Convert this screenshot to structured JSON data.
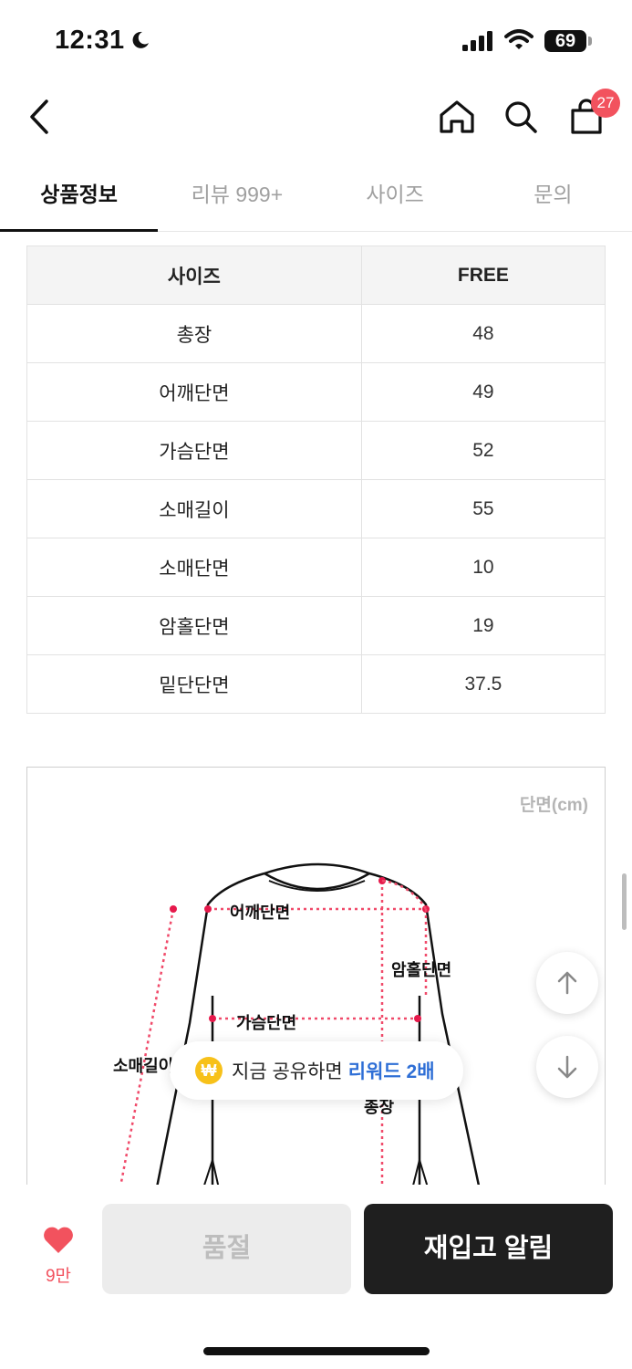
{
  "status_bar": {
    "time": "12:31",
    "battery": "69"
  },
  "header": {
    "cart_count": "27"
  },
  "tabs": [
    {
      "label": "상품정보",
      "active": true
    },
    {
      "label": "리뷰 999+",
      "active": false
    },
    {
      "label": "사이즈",
      "active": false
    },
    {
      "label": "문의",
      "active": false
    }
  ],
  "size_table": {
    "header": [
      "사이즈",
      "FREE"
    ],
    "rows": [
      [
        "총장",
        "48"
      ],
      [
        "어깨단면",
        "49"
      ],
      [
        "가슴단면",
        "52"
      ],
      [
        "소매길이",
        "55"
      ],
      [
        "소매단면",
        "10"
      ],
      [
        "암홀단면",
        "19"
      ],
      [
        "밑단단면",
        "37.5"
      ]
    ]
  },
  "diagram": {
    "unit": "단면(cm)",
    "labels": {
      "shoulder": "어깨단면",
      "armhole": "암홀단면",
      "chest": "가슴단면",
      "sleeve": "소매길이",
      "length": "총장"
    }
  },
  "share_banner": {
    "coin_symbol": "₩",
    "text": "지금 공유하면",
    "highlight": "리워드 2배",
    "highlight_color": "#2f6fd6"
  },
  "bottom_bar": {
    "like_count": "9만",
    "soldout_label": "품절",
    "restock_label": "재입고 알림"
  },
  "colors": {
    "accent_red": "#f2525e",
    "measure_line": "#f04a6a"
  }
}
